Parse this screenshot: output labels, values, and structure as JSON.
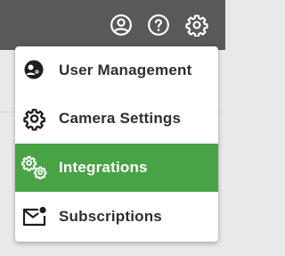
{
  "topbar": {
    "background": "#595959",
    "icon_color": "#ffffff",
    "icons": [
      "user-circle-icon",
      "help-circle-icon",
      "gear-icon"
    ]
  },
  "menu": {
    "accent_color": "#48a346",
    "items": [
      {
        "label": "User Management",
        "icon": "user-settings-icon",
        "active": false
      },
      {
        "label": "Camera Settings",
        "icon": "gear-icon",
        "active": false
      },
      {
        "label": "Integrations",
        "icon": "gears-icon",
        "active": true
      },
      {
        "label": "Subscriptions",
        "icon": "mail-notification-icon",
        "active": false
      }
    ]
  }
}
